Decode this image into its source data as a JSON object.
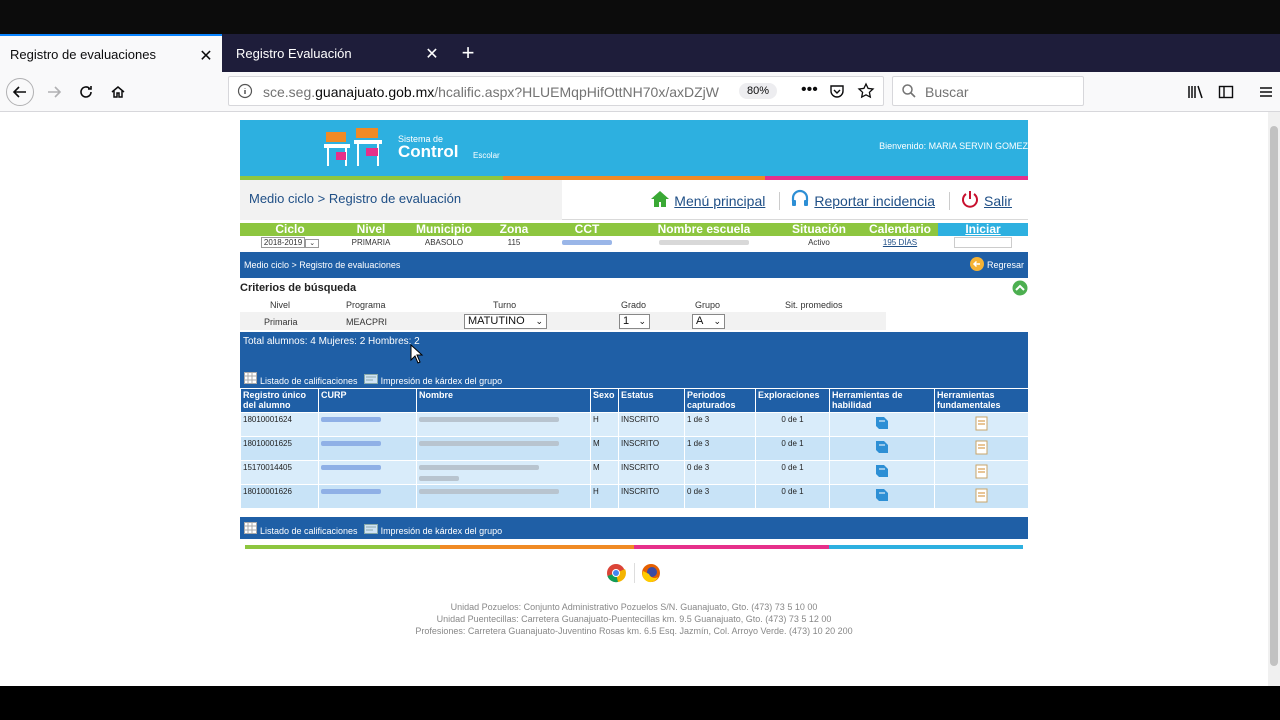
{
  "browser": {
    "tabs": [
      {
        "label": "Registro de evaluaciones",
        "active": true
      },
      {
        "label": "Registro Evaluación",
        "active": false
      }
    ],
    "url_prefix": "sce.seg.",
    "url_domain": "guanajuato.gob.mx",
    "url_path": "/hcalific.aspx?HLUEMqpHifOttNH70x/axDZjW",
    "zoom": "80%",
    "search_placeholder": "Buscar"
  },
  "header": {
    "logo_small": "Sistema de",
    "logo_big": "Control",
    "logo_suffix": "Escolar",
    "welcome": "Bienvenido: MARIA SERVIN GOMEZ"
  },
  "subnav": {
    "breadcrumb": "Medio ciclo > Registro de evaluación",
    "menu": "Menú principal",
    "report": "Reportar incidencia",
    "exit": "Salir"
  },
  "info": {
    "headers": [
      "Ciclo",
      "Nivel",
      "Municipio",
      "Zona",
      "CCT",
      "Nombre escuela",
      "Situación",
      "Calendario",
      "Iniciar"
    ],
    "ciclo": "2018-2019",
    "nivel": "PRIMARIA",
    "municipio": "ABASOLO",
    "zona": "115",
    "situacion": "Activo",
    "calendario": "195 DÍAS"
  },
  "section": {
    "breadcrumb": "Medio ciclo > Registro de evaluaciones",
    "back": "Regresar"
  },
  "criteria": {
    "title": "Criterios de búsqueda",
    "labels": {
      "nivel": "Nivel",
      "programa": "Programa",
      "turno": "Turno",
      "grado": "Grado",
      "grupo": "Grupo",
      "promedios": "Sit. promedios"
    },
    "values": {
      "nivel": "Primaria",
      "programa": "MEACPRI",
      "turno": "MATUTINO",
      "grado": "1",
      "grupo": "A"
    }
  },
  "totals": "Total alumnos: 4 Mujeres: 2 Hombres: 2",
  "links": {
    "list": "Listado de calificaciones",
    "kardex": "Impresión de kárdex del grupo"
  },
  "table": {
    "headers": {
      "registro": "Registro único del alumno",
      "curp": "CURP",
      "nombre": "Nombre",
      "sexo": "Sexo",
      "estatus": "Estatus",
      "periodos": "Periodos capturados",
      "exploraciones": "Exploraciones",
      "habilidad": "Herramientas de habilidad",
      "fundamentales": "Herramientas fundamentales"
    },
    "rows": [
      {
        "registro": "18010001624",
        "sexo": "H",
        "estatus": "INSCRITO",
        "periodos": "1 de 3",
        "exploraciones": "0 de 1"
      },
      {
        "registro": "18010001625",
        "sexo": "M",
        "estatus": "INSCRITO",
        "periodos": "1 de 3",
        "exploraciones": "0 de 1"
      },
      {
        "registro": "15170014405",
        "sexo": "M",
        "estatus": "INSCRITO",
        "periodos": "0 de 3",
        "exploraciones": "0 de 1"
      },
      {
        "registro": "18010001626",
        "sexo": "H",
        "estatus": "INSCRITO",
        "periodos": "0 de 3",
        "exploraciones": "0 de 1"
      }
    ]
  },
  "footer": {
    "lines": [
      "Unidad Pozuelos: Conjunto Administrativo Pozuelos S/N. Guanajuato, Gto. (473) 73 5 10 00",
      "Unidad Puentecillas: Carretera Guanajuato-Puentecillas km. 9.5 Guanajuato, Gto. (473) 73 5 12 00",
      "Profesiones: Carretera Guanajuato-Juventino Rosas km. 6.5 Esq. Jazmín, Col. Arroyo Verde. (473) 10 20 200"
    ]
  },
  "colors": {
    "blue": "#1f5fa6",
    "cyan": "#2db0e0",
    "green": "#8dc63f",
    "orange": "#f08a24",
    "pink": "#e6308a"
  }
}
